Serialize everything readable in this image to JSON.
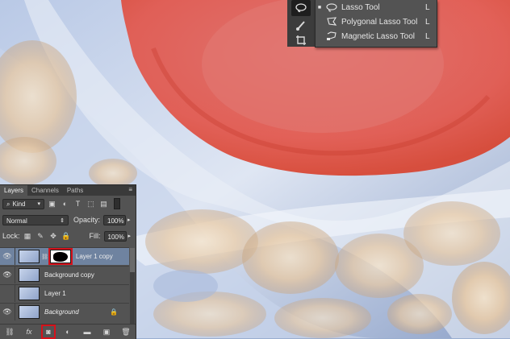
{
  "tools": {
    "flyout": [
      {
        "label": "Lasso Tool",
        "shortcut": "L",
        "icon": "lasso-icon",
        "selected": true
      },
      {
        "label": "Polygonal Lasso Tool",
        "shortcut": "L",
        "icon": "polygonal-lasso-icon",
        "selected": false
      },
      {
        "label": "Magnetic Lasso Tool",
        "shortcut": "L",
        "icon": "magnetic-lasso-icon",
        "selected": false
      }
    ]
  },
  "layers_panel": {
    "tabs": [
      "Layers",
      "Channels",
      "Paths"
    ],
    "filter_kind": "Kind",
    "blend_mode": "Normal",
    "opacity_label": "Opacity:",
    "opacity_value": "100%",
    "lock_label": "Lock:",
    "fill_label": "Fill:",
    "fill_value": "100%",
    "layers": [
      {
        "name": "Layer 1 copy",
        "visible": true,
        "has_mask": true,
        "selected": true,
        "italic": false
      },
      {
        "name": "Background copy",
        "visible": true,
        "has_mask": false,
        "selected": false,
        "italic": false
      },
      {
        "name": "Layer 1",
        "visible": false,
        "has_mask": false,
        "selected": false,
        "italic": false
      },
      {
        "name": "Background",
        "visible": true,
        "has_mask": false,
        "selected": false,
        "italic": true,
        "locked": true
      }
    ]
  },
  "colors": {
    "quick_mask": "#e24b3e",
    "selection_highlight": "#6f83a0",
    "annotation_red": "#d6121b"
  }
}
